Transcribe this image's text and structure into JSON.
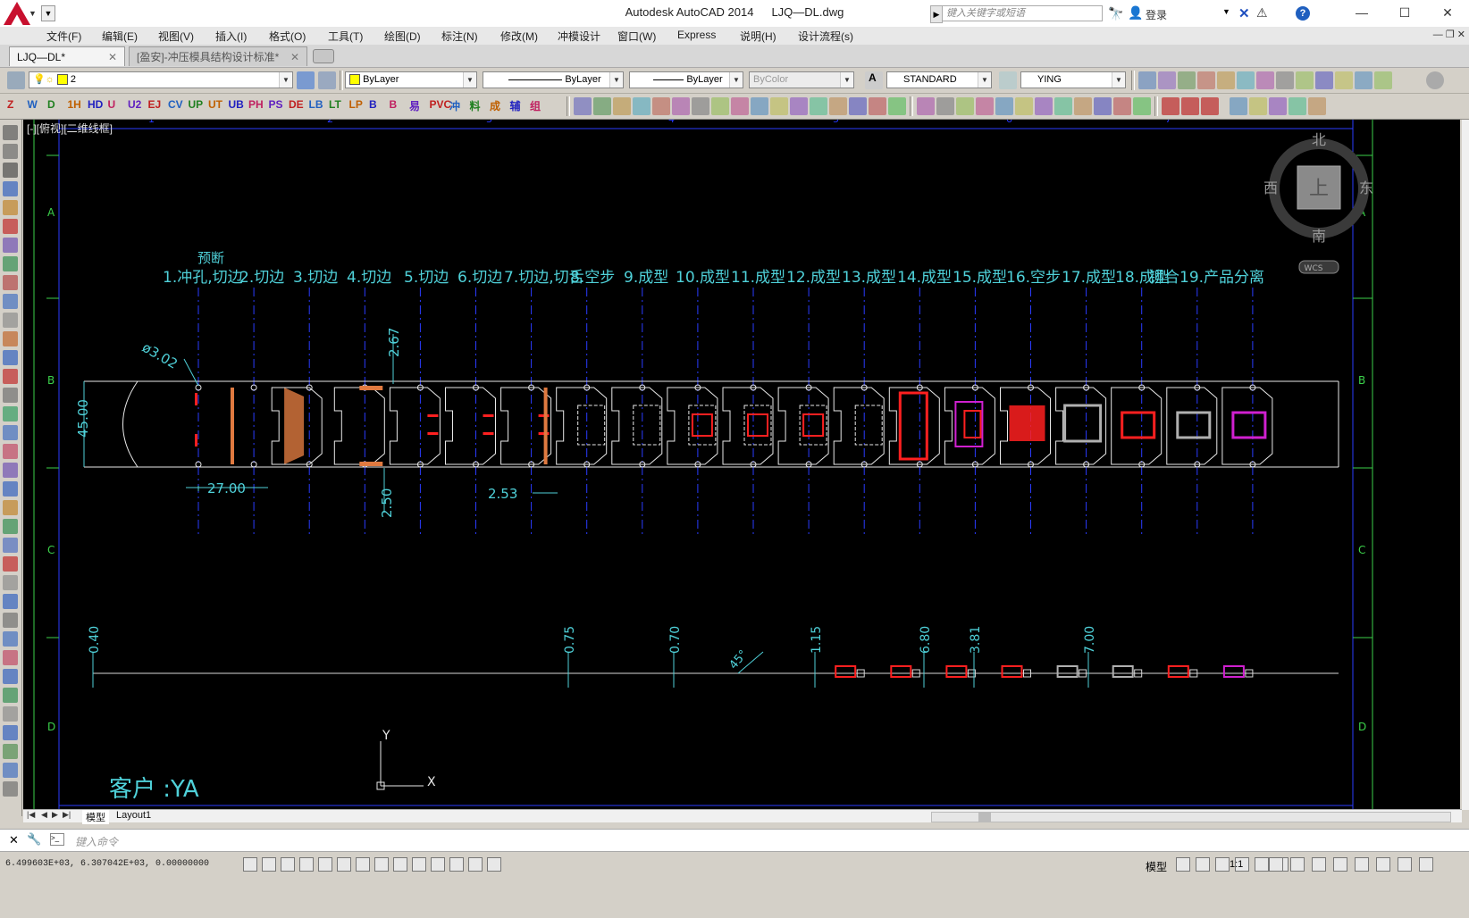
{
  "window": {
    "app_name": "Autodesk AutoCAD 2014",
    "file_name": "LJQ—DL.dwg",
    "search_placeholder": "键入关键字或短语",
    "login_label": "登录"
  },
  "menu": [
    "文件(F)",
    "编辑(E)",
    "视图(V)",
    "插入(I)",
    "格式(O)",
    "工具(T)",
    "绘图(D)",
    "标注(N)",
    "修改(M)",
    "冲模设计",
    "窗口(W)",
    "Express",
    "说明(H)",
    "设计流程(s)"
  ],
  "tabs": {
    "active": "LJQ—DL*",
    "inactive": "[盈安]-冲压模具结构设计标准*"
  },
  "toolbar": {
    "layer_value": "2",
    "color_value": "ByLayer",
    "linetype_value": "ByLayer",
    "lineweight_value": "ByLayer",
    "plotstyle_value": "ByColor",
    "textstyle_value": "STANDARD",
    "dimstyle_value": "YING"
  },
  "viewport": {
    "label": "[-][俯视][二维线框]"
  },
  "viewcube": {
    "north": "北",
    "south": "南",
    "east": "东",
    "west": "西",
    "top": "上",
    "wcs": "WCS"
  },
  "drawing": {
    "grid_cols": [
      "1",
      "2",
      "3",
      "4",
      "5",
      "6",
      "7"
    ],
    "grid_rows": [
      "A",
      "B",
      "C",
      "D"
    ],
    "pre_cut_label": "预断",
    "stations": [
      "1.冲孔,切边",
      "2.切边",
      "3.切边",
      "4.切边",
      "5.切边",
      "6.切边",
      "7.切边,切舌",
      "8.空步",
      "9.成型",
      "10.成型",
      "11.成型",
      "12.成型",
      "13.成型",
      "14.成型",
      "15.成型",
      "16.空步",
      "17.成型",
      "18.成型",
      "铆合",
      "19.产品分离"
    ],
    "dims": {
      "hole_dia": "ø3.02",
      "width": "45.00",
      "pitch": "27.00",
      "d267": "2.67",
      "d250": "2.50",
      "d253": "2.53",
      "s040": "0.40",
      "s075": "0.75",
      "s070": "0.70",
      "angle": "45°",
      "s115": "1.15",
      "s680": "6.80",
      "s381": "3.81",
      "s700": "7.00"
    },
    "customer": "客户 :YA",
    "ucs_x": "X",
    "ucs_y": "Y",
    "colors": {
      "strip": "#e8e8e8",
      "dim": "#4fd1d9",
      "center": "#2a3bff",
      "feature": "#ff2020",
      "hatch": "#e07a40",
      "product": "#d020d0",
      "border": "#3bd14a"
    }
  },
  "layout_tabs": [
    "模型",
    "Layout1"
  ],
  "command": {
    "placeholder": "键入命令"
  },
  "status": {
    "coords": "6.499603E+03,  6.307042E+03,  0.00000000",
    "model": "模型",
    "scale": "1:1"
  }
}
